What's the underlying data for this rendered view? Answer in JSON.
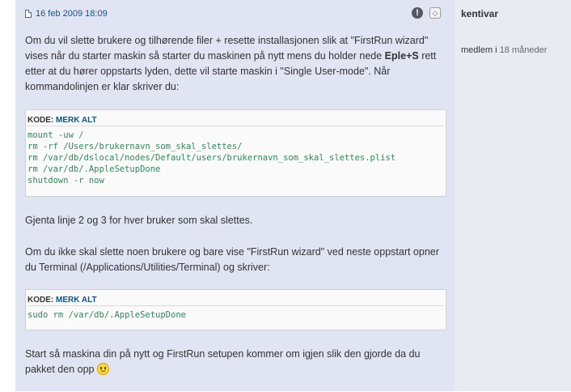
{
  "post": {
    "date": "16 feb 2009 18:09",
    "report_glyph": "!",
    "info_glyph": "◇",
    "paragraphs": {
      "p1_a": "Om du vil slette brukere og tilhørende filer + resette installasjonen slik at \"FirstRun wizard\" vises når du starter maskin så starter du maskinen på nytt mens du holder nede ",
      "p1_bold": "Eple+S",
      "p1_b": " rett etter at du hører oppstarts lyden, dette vil starte maskin i \"Single User-mode\". Når kommandolinjen er klar skriver du:",
      "p2": "Gjenta linje 2 og 3 for hver bruker som skal slettes.",
      "p3": "Om du ikke skal slette noen brukere og bare vise \"FirstRun wizard\" ved neste oppstart opner du Terminal (/Applications/Utilities/Terminal) og skriver:",
      "p4": "Start så maskina din på nytt og FirstRun setupen kommer om igjen slik den gjorde da du pakket den opp"
    },
    "code_blocks": [
      {
        "label": "KODE:",
        "select_all": "MERK ALT",
        "code": "mount -uw /\nrm -rf /Users/brukernavn_som_skal_slettes/\nrm /var/db/dslocal/nodes/Default/users/brukernavn_som_skal_slettes.plist\nrm /var/db/.AppleSetupDone\nshutdown -r now"
      },
      {
        "label": "KODE:",
        "select_all": "MERK ALT",
        "code": "sudo rm /var/db/.AppleSetupDone"
      }
    ]
  },
  "author": {
    "username": "kentivar",
    "member_label": "medlem i",
    "member_duration": "18 måneder"
  },
  "colors": {
    "post_bg": "#e1e4f2",
    "profile_bg": "#e9ebf3",
    "link": "#105289",
    "code_text": "#2e8b57"
  }
}
